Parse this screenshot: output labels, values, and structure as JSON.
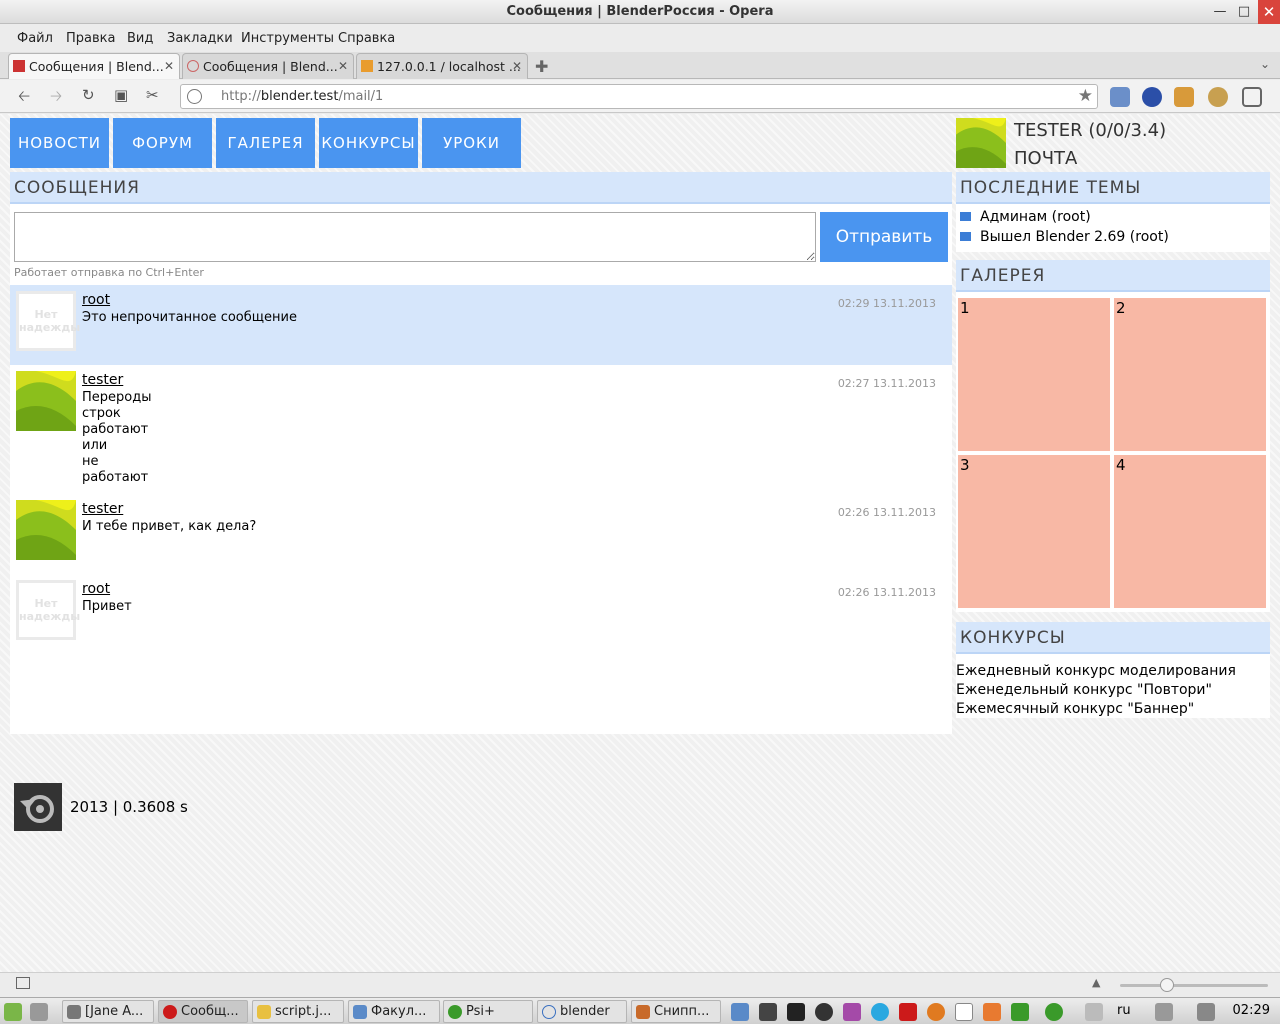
{
  "window": {
    "title": "Сообщения | BlenderРоссия - Opera"
  },
  "menu": [
    "Файл",
    "Правка",
    "Вид",
    "Закладки",
    "Инструменты",
    "Справка"
  ],
  "tabs": [
    {
      "label": "Сообщения | Blend..."
    },
    {
      "label": "Сообщения | Blend..."
    },
    {
      "label": "127.0.0.1 / localhost ..."
    }
  ],
  "address": {
    "scheme": "http://",
    "host": "blender.test",
    "path": "/mail/1"
  },
  "nav": [
    "НОВОСТИ",
    "ФОРУМ",
    "ГАЛЕРЕЯ",
    "КОНКУРСЫ",
    "УРОКИ"
  ],
  "messages_section": {
    "title": "СООБЩЕНИЯ",
    "send_label": "Отправить",
    "hint": "Работает отправка по Ctrl+Enter",
    "input_value": ""
  },
  "messages": [
    {
      "author": "root",
      "text": "Это непрочитанное сообщение",
      "date": "02:29 13.11.2013",
      "avatar": "Нет надежды",
      "unread": true
    },
    {
      "author": "tester",
      "text": "Перероды\nстрок\nработают\nили\nне\nработают",
      "date": "02:27 13.11.2013",
      "unread": false
    },
    {
      "author": "tester",
      "text": "И тебе привет, как дела?",
      "date": "02:26 13.11.2013",
      "unread": false
    },
    {
      "author": "root",
      "text": "Привет",
      "date": "02:26 13.11.2013",
      "avatar": "Нет надежды",
      "unread": false
    }
  ],
  "footer": {
    "text": "2013 | 0.3608 s"
  },
  "user": {
    "name": "TESTER (0/0/3.4)",
    "mail": "ПОЧТА"
  },
  "latest_topics": {
    "title": "ПОСЛЕДНИЕ ТЕМЫ",
    "items": [
      {
        "title": "Админам",
        "author": "(root)"
      },
      {
        "title": "Вышел Blender 2.69",
        "author": "(root)"
      }
    ]
  },
  "gallery": {
    "title": "ГАЛЕРЕЯ",
    "cells": [
      "1",
      "2",
      "3",
      "4"
    ]
  },
  "contests": {
    "title": "КОНКУРСЫ",
    "items": [
      "Ежедневный конкурс моделирования",
      "Еженедельный конкурс \"Повтори\"",
      "Ежемесячный конкурс \"Баннер\""
    ]
  },
  "zoom_level": 0.3,
  "taskbar": {
    "tasks": [
      "[Jane A...",
      "Сообщ...",
      "script.j...",
      "Факул...",
      "Psi+",
      "blender",
      "Снипп..."
    ],
    "lang": "ru",
    "clock": "02:29"
  },
  "colors": {
    "accent": "#4a95f0",
    "section_bg": "#d6e6fb",
    "gallery_cell": "#f8b8a5"
  }
}
